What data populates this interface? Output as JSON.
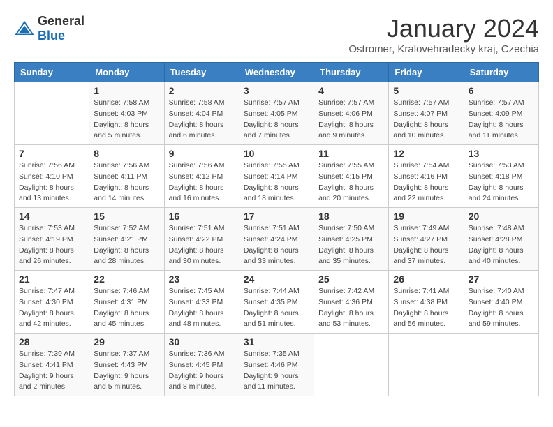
{
  "header": {
    "logo_general": "General",
    "logo_blue": "Blue",
    "month_title": "January 2024",
    "subtitle": "Ostromer, Kralovehradecky kraj, Czechia"
  },
  "days_of_week": [
    "Sunday",
    "Monday",
    "Tuesday",
    "Wednesday",
    "Thursday",
    "Friday",
    "Saturday"
  ],
  "weeks": [
    [
      {
        "day": "",
        "info": ""
      },
      {
        "day": "1",
        "info": "Sunrise: 7:58 AM\nSunset: 4:03 PM\nDaylight: 8 hours\nand 5 minutes."
      },
      {
        "day": "2",
        "info": "Sunrise: 7:58 AM\nSunset: 4:04 PM\nDaylight: 8 hours\nand 6 minutes."
      },
      {
        "day": "3",
        "info": "Sunrise: 7:57 AM\nSunset: 4:05 PM\nDaylight: 8 hours\nand 7 minutes."
      },
      {
        "day": "4",
        "info": "Sunrise: 7:57 AM\nSunset: 4:06 PM\nDaylight: 8 hours\nand 9 minutes."
      },
      {
        "day": "5",
        "info": "Sunrise: 7:57 AM\nSunset: 4:07 PM\nDaylight: 8 hours\nand 10 minutes."
      },
      {
        "day": "6",
        "info": "Sunrise: 7:57 AM\nSunset: 4:09 PM\nDaylight: 8 hours\nand 11 minutes."
      }
    ],
    [
      {
        "day": "7",
        "info": "Sunrise: 7:56 AM\nSunset: 4:10 PM\nDaylight: 8 hours\nand 13 minutes."
      },
      {
        "day": "8",
        "info": "Sunrise: 7:56 AM\nSunset: 4:11 PM\nDaylight: 8 hours\nand 14 minutes."
      },
      {
        "day": "9",
        "info": "Sunrise: 7:56 AM\nSunset: 4:12 PM\nDaylight: 8 hours\nand 16 minutes."
      },
      {
        "day": "10",
        "info": "Sunrise: 7:55 AM\nSunset: 4:14 PM\nDaylight: 8 hours\nand 18 minutes."
      },
      {
        "day": "11",
        "info": "Sunrise: 7:55 AM\nSunset: 4:15 PM\nDaylight: 8 hours\nand 20 minutes."
      },
      {
        "day": "12",
        "info": "Sunrise: 7:54 AM\nSunset: 4:16 PM\nDaylight: 8 hours\nand 22 minutes."
      },
      {
        "day": "13",
        "info": "Sunrise: 7:53 AM\nSunset: 4:18 PM\nDaylight: 8 hours\nand 24 minutes."
      }
    ],
    [
      {
        "day": "14",
        "info": "Sunrise: 7:53 AM\nSunset: 4:19 PM\nDaylight: 8 hours\nand 26 minutes."
      },
      {
        "day": "15",
        "info": "Sunrise: 7:52 AM\nSunset: 4:21 PM\nDaylight: 8 hours\nand 28 minutes."
      },
      {
        "day": "16",
        "info": "Sunrise: 7:51 AM\nSunset: 4:22 PM\nDaylight: 8 hours\nand 30 minutes."
      },
      {
        "day": "17",
        "info": "Sunrise: 7:51 AM\nSunset: 4:24 PM\nDaylight: 8 hours\nand 33 minutes."
      },
      {
        "day": "18",
        "info": "Sunrise: 7:50 AM\nSunset: 4:25 PM\nDaylight: 8 hours\nand 35 minutes."
      },
      {
        "day": "19",
        "info": "Sunrise: 7:49 AM\nSunset: 4:27 PM\nDaylight: 8 hours\nand 37 minutes."
      },
      {
        "day": "20",
        "info": "Sunrise: 7:48 AM\nSunset: 4:28 PM\nDaylight: 8 hours\nand 40 minutes."
      }
    ],
    [
      {
        "day": "21",
        "info": "Sunrise: 7:47 AM\nSunset: 4:30 PM\nDaylight: 8 hours\nand 42 minutes."
      },
      {
        "day": "22",
        "info": "Sunrise: 7:46 AM\nSunset: 4:31 PM\nDaylight: 8 hours\nand 45 minutes."
      },
      {
        "day": "23",
        "info": "Sunrise: 7:45 AM\nSunset: 4:33 PM\nDaylight: 8 hours\nand 48 minutes."
      },
      {
        "day": "24",
        "info": "Sunrise: 7:44 AM\nSunset: 4:35 PM\nDaylight: 8 hours\nand 51 minutes."
      },
      {
        "day": "25",
        "info": "Sunrise: 7:42 AM\nSunset: 4:36 PM\nDaylight: 8 hours\nand 53 minutes."
      },
      {
        "day": "26",
        "info": "Sunrise: 7:41 AM\nSunset: 4:38 PM\nDaylight: 8 hours\nand 56 minutes."
      },
      {
        "day": "27",
        "info": "Sunrise: 7:40 AM\nSunset: 4:40 PM\nDaylight: 8 hours\nand 59 minutes."
      }
    ],
    [
      {
        "day": "28",
        "info": "Sunrise: 7:39 AM\nSunset: 4:41 PM\nDaylight: 9 hours\nand 2 minutes."
      },
      {
        "day": "29",
        "info": "Sunrise: 7:37 AM\nSunset: 4:43 PM\nDaylight: 9 hours\nand 5 minutes."
      },
      {
        "day": "30",
        "info": "Sunrise: 7:36 AM\nSunset: 4:45 PM\nDaylight: 9 hours\nand 8 minutes."
      },
      {
        "day": "31",
        "info": "Sunrise: 7:35 AM\nSunset: 4:46 PM\nDaylight: 9 hours\nand 11 minutes."
      },
      {
        "day": "",
        "info": ""
      },
      {
        "day": "",
        "info": ""
      },
      {
        "day": "",
        "info": ""
      }
    ]
  ]
}
